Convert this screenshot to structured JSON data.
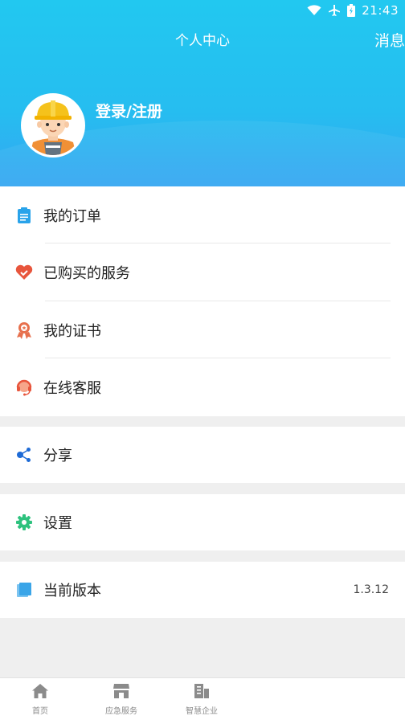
{
  "status_bar": {
    "time": "21:43"
  },
  "header": {
    "title": "个人中心",
    "message_label": "消息"
  },
  "profile": {
    "login_label": "登录/注册"
  },
  "menu": {
    "orders": "我的订单",
    "purchased_services": "已购买的服务",
    "certificates": "我的证书",
    "online_support": "在线客服",
    "share": "分享",
    "settings": "设置",
    "version_label": "当前版本",
    "version_value": "1.3.12"
  },
  "bottom_nav": {
    "items": [
      {
        "label": "首页"
      },
      {
        "label": "应急服务"
      },
      {
        "label": "智慧企业"
      }
    ]
  },
  "colors": {
    "header": "#22c8f0",
    "order_icon": "#29a3ea",
    "heart_icon": "#e8553c",
    "cert_icon": "#e7704d",
    "support_icon": "#e8553c",
    "share_icon": "#1e6bd6",
    "settings_icon": "#2ec27e",
    "version_icon": "#3aa5e8"
  }
}
